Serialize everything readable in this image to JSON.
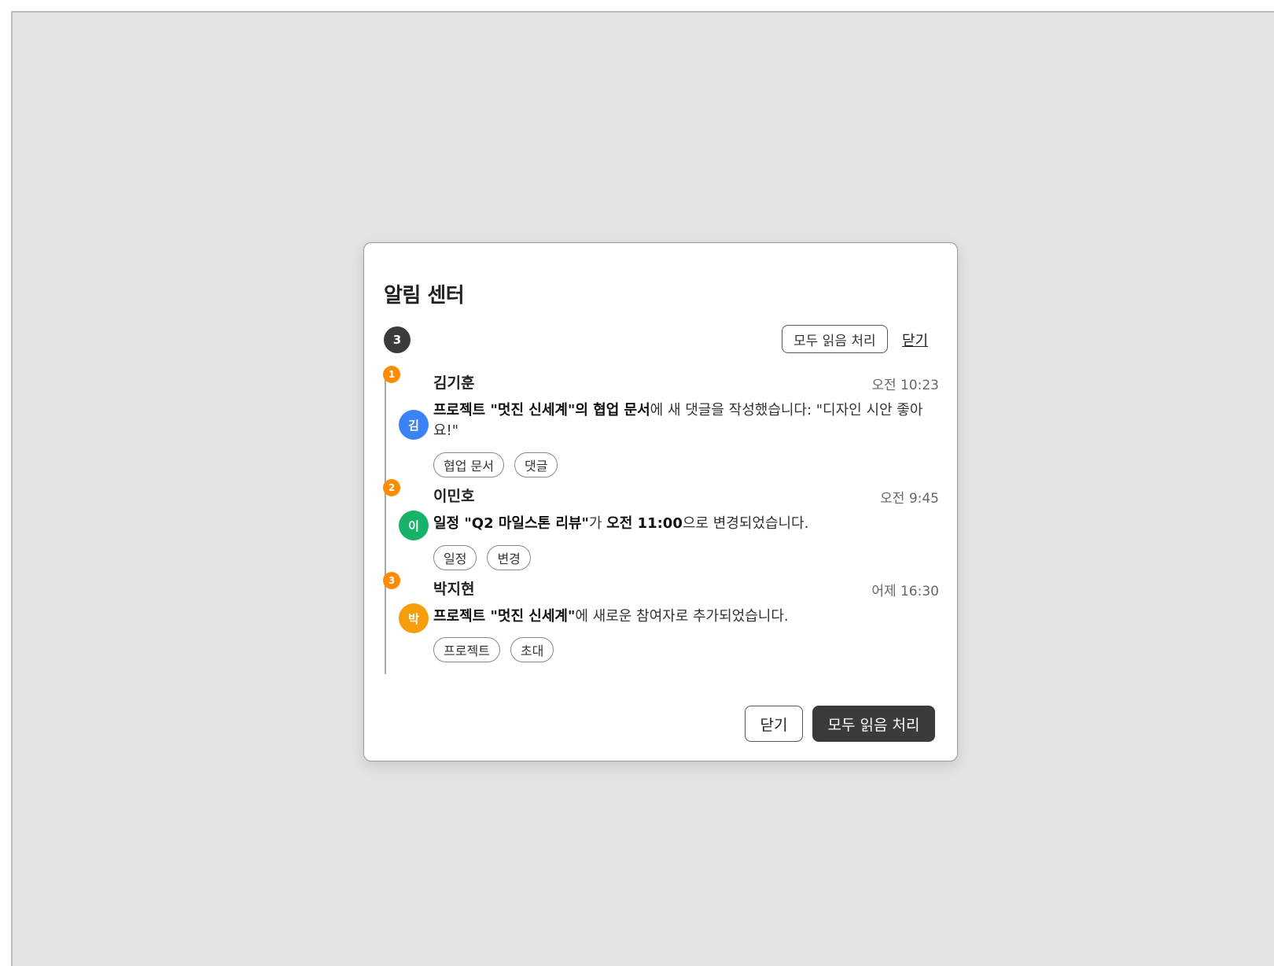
{
  "dialog": {
    "title": "알림 센터",
    "unread_count": "3",
    "header_mark_all_label": "모두 읽음 처리",
    "header_close_label": "닫기",
    "footer_close_label": "닫기",
    "footer_mark_all_label": "모두 읽음 처리"
  },
  "notifications": [
    {
      "index": "1",
      "avatar_initial": "김",
      "avatar_color": "#3b82f6",
      "name": "김기훈",
      "time": "오전 10:23",
      "message_parts": [
        {
          "text": "프로젝트 \"멋진 신세계\"의 협업 문서",
          "bold": true
        },
        {
          "text": "에 새 댓글을 작성했습니다: \"디자인 시안 좋아요!\"",
          "bold": false
        }
      ],
      "tags": [
        "협업 문서",
        "댓글"
      ]
    },
    {
      "index": "2",
      "avatar_initial": "이",
      "avatar_color": "#16b26a",
      "name": "이민호",
      "time": "오전 9:45",
      "message_parts": [
        {
          "text": "일정 \"Q2 마일스톤 리뷰\"",
          "bold": true
        },
        {
          "text": "가 ",
          "bold": false
        },
        {
          "text": "오전 11:00",
          "bold": true
        },
        {
          "text": "으로 변경되었습니다.",
          "bold": false
        }
      ],
      "tags": [
        "일정",
        "변경"
      ]
    },
    {
      "index": "3",
      "avatar_initial": "박",
      "avatar_color": "#f59e0b",
      "name": "박지현",
      "time": "어제 16:30",
      "message_parts": [
        {
          "text": "프로젝트 \"멋진 신세계\"",
          "bold": true
        },
        {
          "text": "에 새로운 참여자로 추가되었습니다.",
          "bold": false
        }
      ],
      "tags": [
        "프로젝트",
        "초대"
      ]
    }
  ],
  "colors": {
    "index_badge": "#ff8c00",
    "primary_button": "#3b3b3b",
    "backdrop": "#e4e4e4"
  }
}
